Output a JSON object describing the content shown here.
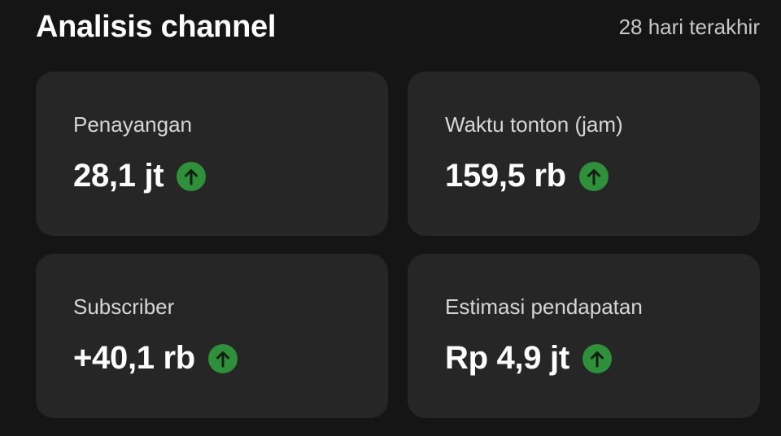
{
  "header": {
    "title": "Analisis channel",
    "period": "28 hari terakhir"
  },
  "metrics": [
    {
      "label": "Penayangan",
      "value": "28,1 jt",
      "trend": "up",
      "trend_icon": "arrow-up-icon"
    },
    {
      "label": "Waktu tonton (jam)",
      "value": "159,5 rb",
      "trend": "up",
      "trend_icon": "arrow-up-icon"
    },
    {
      "label": "Subscriber",
      "value": "+40,1 rb",
      "trend": "up",
      "trend_icon": "arrow-up-icon"
    },
    {
      "label": "Estimasi pendapatan",
      "value": "Rp 4,9 jt",
      "trend": "up",
      "trend_icon": "arrow-up-icon"
    }
  ],
  "colors": {
    "background": "#151515",
    "card": "#262626",
    "trend_up": "#2f8f3a"
  }
}
